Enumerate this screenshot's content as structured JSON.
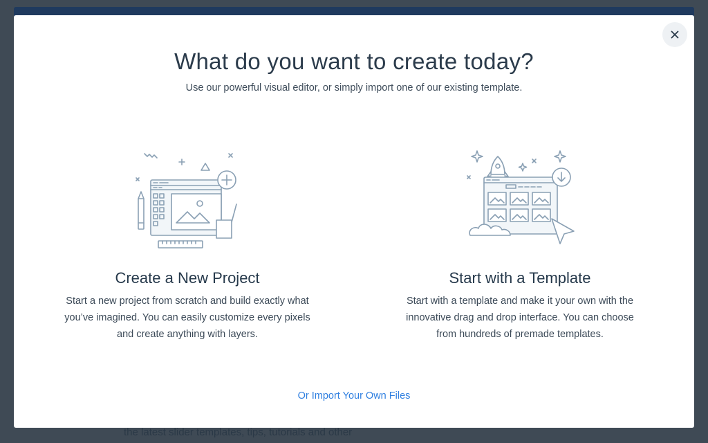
{
  "background": {
    "partial_text": "the latest slider templates, tips, tutorials and other"
  },
  "modal": {
    "close_icon": "close-icon",
    "title": "What do you want to create today?",
    "subtitle": "Use our powerful visual editor, or simply import one of our existing template.",
    "options": [
      {
        "icon": "editor-canvas-illustration",
        "title": "Create a New Project",
        "description": "Start a new project from scratch and build exactly what you’ve imagined. You can easily customize every pixels and create anything with layers."
      },
      {
        "icon": "template-rocket-illustration",
        "title": "Start with a Template",
        "description": "Start with a template and make it your own with the innovative drag and drop interface. You can choose from hundreds of premade templates."
      }
    ],
    "import_link": "Or Import Your Own Files"
  },
  "colors": {
    "overlay": "#3f4a55",
    "accent_link": "#2f7fe0",
    "heading": "#2b3b4b",
    "illustration_stroke": "#8aa0b4"
  }
}
